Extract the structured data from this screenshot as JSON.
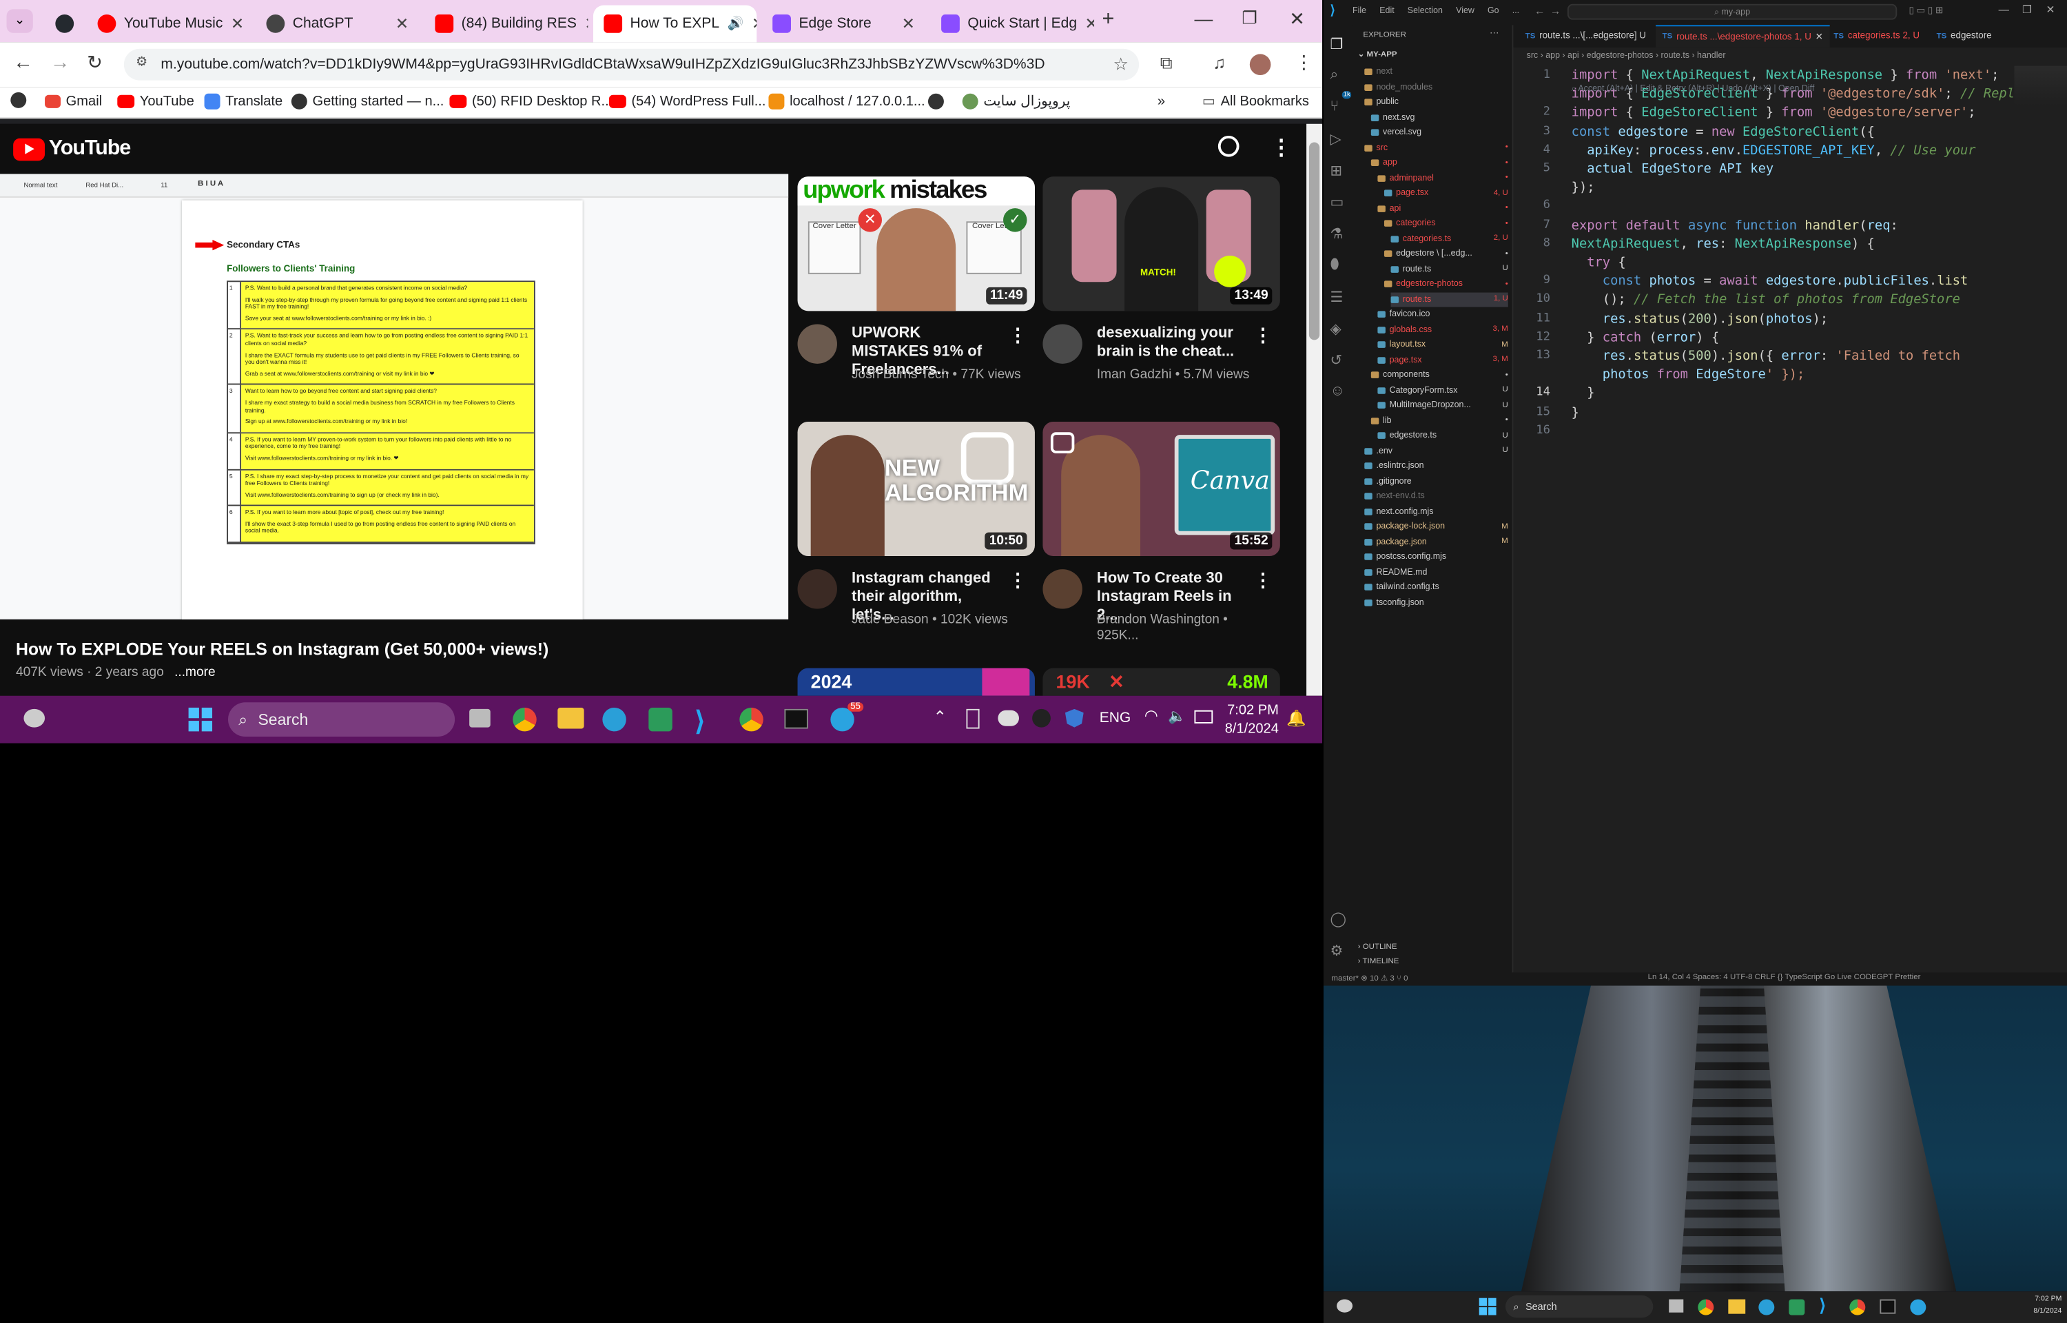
{
  "chrome": {
    "tabs": [
      {
        "label": "",
        "icon": "github-icon",
        "color": "#24292f"
      },
      {
        "label": "YouTube Music",
        "icon": "youtube-music-icon",
        "color": "#ff0000"
      },
      {
        "label": "ChatGPT",
        "icon": "chatgpt-icon",
        "color": "#444444"
      },
      {
        "label": "(84) Building RES",
        "icon": "youtube-icon",
        "color": "#ff0000"
      },
      {
        "label": "How To EXPL",
        "icon": "youtube-icon",
        "color": "#ff0000",
        "active": true
      },
      {
        "label": "Edge Store",
        "icon": "edgestore-icon",
        "color": "#8a4dff"
      },
      {
        "label": "Quick Start | Edg",
        "icon": "edgestore-icon",
        "color": "#8a4dff"
      }
    ],
    "url": "m.youtube.com/watch?v=DD1kDIy9WM4&pp=ygUraG93IHRvIGdldCBtaWxsaW9uIHZpZXdzIG9uIGluc3RhZ3JhbSBzYZWVscw%3D%3D",
    "bookmarks": [
      {
        "label": "Gmail",
        "icon": "gmail-icon",
        "color": "#ea4335"
      },
      {
        "label": "YouTube",
        "icon": "youtube-icon",
        "color": "#ff0000"
      },
      {
        "label": "Translate",
        "icon": "translate-icon",
        "color": "#4285f4"
      },
      {
        "label": "Getting started — n...",
        "icon": "nextjs-icon",
        "color": "#333333"
      },
      {
        "label": "(50) RFID Desktop R...",
        "icon": "youtube-icon",
        "color": "#ff0000"
      },
      {
        "label": "(54) WordPress Full...",
        "icon": "youtube-icon",
        "color": "#ff0000"
      },
      {
        "label": "localhost / 127.0.0.1...",
        "icon": "phpmyadmin-icon",
        "color": "#f29111"
      },
      {
        "label": "",
        "icon": "globe-icon",
        "color": "#333333"
      },
      {
        "label": "پروپوزال سایت",
        "icon": "site-icon",
        "color": "#6a9955"
      }
    ],
    "all_bookmarks": "All Bookmarks"
  },
  "youtube": {
    "logo": "YouTube",
    "video_title": "How To EXPLODE Your REELS on Instagram (Get 50,000+ views!)",
    "video_meta": "407K views · 2 years ago",
    "more": "...more",
    "doc": {
      "heading": "Secondary CTAs",
      "subheading": "Followers to Clients' Training",
      "toolbar_style": "Normal text",
      "toolbar_font": "Red Hat Di...",
      "toolbar_size": "11",
      "rows": [
        {
          "n": "1",
          "lines": [
            "P.S. Want to build a personal brand that generates consistent income on social media?",
            "I'll walk you step-by-step through my proven formula for going beyond free content and signing paid 1:1 clients FAST in my free training!",
            "Save your seat at www.followerstoclients.com/training or my link in bio. :)"
          ]
        },
        {
          "n": "2",
          "lines": [
            "P.S. Want to fast-track your success and learn how to go from posting endless free content to signing PAID 1:1 clients on social media?",
            "I share the EXACT formula my students use to get paid clients in my FREE Followers to Clients training, so you don't wanna miss it!",
            "Grab a seat at www.followerstoclients.com/training or visit my link in bio ❤"
          ]
        },
        {
          "n": "3",
          "lines": [
            "Want to learn how to go beyond free content and start signing paid clients?",
            "I share my exact strategy to build a social media business from SCRATCH in my free Followers to Clients training.",
            "Sign up at www.followerstoclients.com/training or my link in bio!"
          ]
        },
        {
          "n": "4",
          "lines": [
            "P.S. If you want to learn MY proven-to-work system to turn your followers into paid clients with little to no experience, come to my free training!",
            "Visit www.followerstoclients.com/training or my link in bio. ❤"
          ]
        },
        {
          "n": "5",
          "lines": [
            "P.S. I share my exact step-by-step process to monetize your content and get paid clients on social media in my free Followers to Clients training!",
            "Visit www.followerstoclients.com/training to sign up (or check my link in bio)."
          ]
        },
        {
          "n": "6",
          "lines": [
            "P.S. If you want to learn more about [topic of post], check out my free training!",
            "I'll show the exact 3-step formula I used to go from posting endless free content to signing PAID clients on social media."
          ]
        }
      ]
    },
    "recommendations": [
      {
        "title": "UPWORK MISTAKES 91% of Freelancers...",
        "channel": "Josh Burns Tech • 77K views",
        "duration": "11:49",
        "thumb_text": "upwork mistakes",
        "thumb_bg": "#e9e9e9"
      },
      {
        "title": "desexualizing your brain is the cheat...",
        "channel": "Iman Gadzhi • 5.7M views",
        "duration": "13:49",
        "thumb_text": "MATCH!",
        "thumb_bg": "#2b2b2b"
      },
      {
        "title": "Instagram changed their algorithm, let's...",
        "channel": "Jade Beason • 102K views",
        "duration": "10:50",
        "thumb_text": "NEW ALGORITHM",
        "thumb_bg": "#d8d2cb"
      },
      {
        "title": "How To Create 30 Instagram Reels in 2...",
        "channel": "Brandon Washington • 925K...",
        "duration": "15:52",
        "thumb_text": "Canva",
        "thumb_bg": "#6a3a4a"
      }
    ],
    "partial_thumbs": [
      "2024",
      "19K",
      "4.8M"
    ]
  },
  "taskbar": {
    "search": "Search",
    "lang": "ENG",
    "time": "7:02 PM",
    "date": "8/1/2024",
    "telegram_badge": "55"
  },
  "vscode": {
    "menu": [
      "File",
      "Edit",
      "Selection",
      "View",
      "Go",
      "..."
    ],
    "search": "my-app",
    "explorer_title": "EXPLORER",
    "project": "MY-APP",
    "tree": [
      {
        "label": "next",
        "indent": 1,
        "type": "folder",
        "color": "#777777",
        "status": ""
      },
      {
        "label": "node_modules",
        "indent": 1,
        "type": "folder",
        "color": "#777777",
        "status": ""
      },
      {
        "label": "public",
        "indent": 1,
        "type": "folder",
        "color": "#cccccc",
        "status": ""
      },
      {
        "label": "next.svg",
        "indent": 2,
        "type": "file",
        "color": "#cccccc",
        "status": ""
      },
      {
        "label": "vercel.svg",
        "indent": 2,
        "type": "file",
        "color": "#cccccc",
        "status": ""
      },
      {
        "label": "src",
        "indent": 1,
        "type": "folder",
        "color": "#f14c4c",
        "status": "•"
      },
      {
        "label": "app",
        "indent": 2,
        "type": "folder",
        "color": "#f14c4c",
        "status": "•"
      },
      {
        "label": "adminpanel",
        "indent": 3,
        "type": "folder",
        "color": "#f14c4c",
        "status": "•"
      },
      {
        "label": "page.tsx",
        "indent": 4,
        "type": "file",
        "color": "#f14c4c",
        "status": "4, U"
      },
      {
        "label": "api",
        "indent": 3,
        "type": "folder",
        "color": "#f14c4c",
        "status": "•"
      },
      {
        "label": "categories",
        "indent": 4,
        "type": "folder",
        "color": "#f14c4c",
        "status": "•"
      },
      {
        "label": "categories.ts",
        "indent": 5,
        "type": "file",
        "color": "#f14c4c",
        "status": "2, U"
      },
      {
        "label": "edgestore \\ [...edg...",
        "indent": 4,
        "type": "folder",
        "color": "#cccccc",
        "status": "•"
      },
      {
        "label": "route.ts",
        "indent": 5,
        "type": "file",
        "color": "#cccccc",
        "status": "U"
      },
      {
        "label": "edgestore-photos",
        "indent": 4,
        "type": "folder",
        "color": "#f14c4c",
        "status": "•"
      },
      {
        "label": "route.ts",
        "indent": 5,
        "type": "file",
        "color": "#f14c4c",
        "status": "1, U",
        "selected": true
      },
      {
        "label": "favicon.ico",
        "indent": 3,
        "type": "file",
        "color": "#cccccc",
        "status": ""
      },
      {
        "label": "globals.css",
        "indent": 3,
        "type": "file",
        "color": "#f14c4c",
        "status": "3, M"
      },
      {
        "label": "layout.tsx",
        "indent": 3,
        "type": "file",
        "color": "#e2c08d",
        "status": "M"
      },
      {
        "label": "page.tsx",
        "indent": 3,
        "type": "file",
        "color": "#f14c4c",
        "status": "3, M"
      },
      {
        "label": "components",
        "indent": 2,
        "type": "folder",
        "color": "#cccccc",
        "status": "•"
      },
      {
        "label": "CategoryForm.tsx",
        "indent": 3,
        "type": "file",
        "color": "#cccccc",
        "status": "U"
      },
      {
        "label": "MultiImageDropzon...",
        "indent": 3,
        "type": "file",
        "color": "#cccccc",
        "status": "U"
      },
      {
        "label": "lib",
        "indent": 2,
        "type": "folder",
        "color": "#cccccc",
        "status": "•"
      },
      {
        "label": "edgestore.ts",
        "indent": 3,
        "type": "file",
        "color": "#cccccc",
        "status": "U"
      },
      {
        "label": ".env",
        "indent": 1,
        "type": "file",
        "color": "#cccccc",
        "status": "U"
      },
      {
        "label": ".eslintrc.json",
        "indent": 1,
        "type": "file",
        "color": "#cccccc",
        "status": ""
      },
      {
        "label": ".gitignore",
        "indent": 1,
        "type": "file",
        "color": "#cccccc",
        "status": ""
      },
      {
        "label": "next-env.d.ts",
        "indent": 1,
        "type": "file",
        "color": "#777777",
        "status": ""
      },
      {
        "label": "next.config.mjs",
        "indent": 1,
        "type": "file",
        "color": "#cccccc",
        "status": ""
      },
      {
        "label": "package-lock.json",
        "indent": 1,
        "type": "file",
        "color": "#e2c08d",
        "status": "M"
      },
      {
        "label": "package.json",
        "indent": 1,
        "type": "file",
        "color": "#e2c08d",
        "status": "M"
      },
      {
        "label": "postcss.config.mjs",
        "indent": 1,
        "type": "file",
        "color": "#cccccc",
        "status": ""
      },
      {
        "label": "README.md",
        "indent": 1,
        "type": "file",
        "color": "#cccccc",
        "status": ""
      },
      {
        "label": "tailwind.config.ts",
        "indent": 1,
        "type": "file",
        "color": "#cccccc",
        "status": ""
      },
      {
        "label": "tsconfig.json",
        "indent": 1,
        "type": "file",
        "color": "#cccccc",
        "status": ""
      }
    ],
    "outline": "OUTLINE",
    "timeline": "TIMELINE",
    "editor_tabs": [
      {
        "label": "route.ts ...\\[...edgestore]  U",
        "color": "#cccccc"
      },
      {
        "label": "route.ts ...\\edgestore-photos  1, U",
        "color": "#f14c4c",
        "active": true
      },
      {
        "label": "categories.ts  2, U",
        "color": "#f14c4c"
      },
      {
        "label": "edgestore",
        "color": "#cccccc"
      }
    ],
    "breadcrumb": "src › app › api › edgestore-photos › route.ts › handler",
    "inline_hint": "⌕ Accept (Alt+A) | Edit & Retry (Alt+R) | Undo (Alt+X) | Open Diff",
    "status_left": "master*   ⊗ 10 ⚠ 3   ⑂ 0",
    "status_right": "Ln 14, Col 4   Spaces: 4   UTF-8   CRLF   {} TypeScript   Go Live   CODEGPT   Prettier",
    "code_lines": [
      "import { NextApiRequest, NextApiResponse } from 'next';",
      "import { EdgeStoreClient } from '@edgestore/sdk'; // Repla",
      "import { EdgeStoreClient } from '@edgestore/server';",
      "const edgestore = new EdgeStoreClient({",
      "  apiKey: process.env.EDGESTORE_API_KEY, // Use your",
      "  actual EdgeStore API key",
      "});",
      "",
      "export default async function handler(req:",
      "NextApiRequest, res: NextApiResponse) {",
      "  try {",
      "    const photos = await edgestore.publicFiles.list",
      "    (); // Fetch the list of photos from EdgeStore",
      "    res.status(200).json(photos);",
      "  } catch (error) {",
      "    res.status(500).json({ error: 'Failed to fetch",
      "    photos from EdgeStore' });",
      "  }",
      "}",
      ""
    ],
    "line_numbers": [
      "1",
      "",
      "2",
      "3",
      "4",
      "5",
      "",
      "6",
      "7",
      "8",
      "",
      "9",
      "10",
      "11",
      "12",
      "13",
      "",
      "14",
      "15",
      "16"
    ]
  },
  "desktop": {
    "taskbar_search": "Search",
    "time": "7:02 PM",
    "date": "8/1/2024"
  }
}
